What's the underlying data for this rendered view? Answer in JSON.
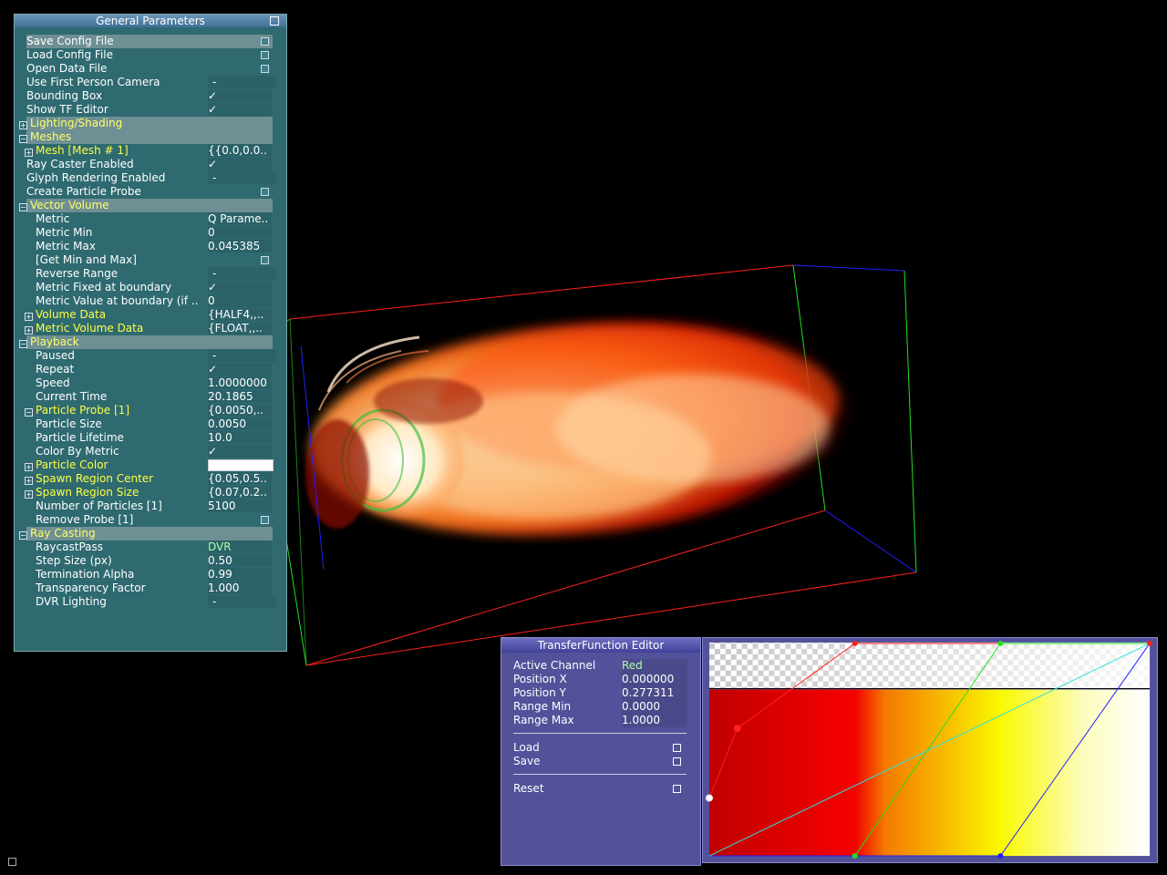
{
  "panel": {
    "title": "General Parameters",
    "items": [
      {
        "label": "Save Config File",
        "type": "button",
        "highlight": true
      },
      {
        "label": "Load Config File",
        "type": "button"
      },
      {
        "label": "Open Data File",
        "type": "button"
      },
      {
        "label": "Use First Person Camera",
        "value": "-"
      },
      {
        "label": "Bounding Box",
        "value": "✓"
      },
      {
        "label": "Show TF Editor",
        "value": "✓"
      },
      {
        "label": "Lighting/Shading",
        "type": "section",
        "expander": "+"
      },
      {
        "label": "Meshes",
        "type": "section",
        "expander": "−"
      },
      {
        "label": "Mesh [Mesh # 1]",
        "value": "{{0.0,0.0..",
        "yellow": true,
        "expander": "+"
      },
      {
        "label": "Ray Caster Enabled",
        "value": "✓"
      },
      {
        "label": "Glyph Rendering Enabled",
        "value": "-"
      },
      {
        "label": "Create Particle Probe",
        "type": "button"
      },
      {
        "label": "Vector Volume",
        "type": "section",
        "expander": "−"
      },
      {
        "label": "Metric",
        "value": "Q Parame..",
        "indent": true
      },
      {
        "label": "Metric Min",
        "value": "0",
        "indent": true
      },
      {
        "label": "Metric Max",
        "value": "0.045385",
        "indent": true
      },
      {
        "label": "[Get Min and Max]",
        "type": "button",
        "indent": true
      },
      {
        "label": "Reverse Range",
        "value": "-",
        "indent": true
      },
      {
        "label": "Metric Fixed at boundary",
        "value": "✓",
        "indent": true
      },
      {
        "label": "Metric Value at boundary (if ..",
        "value": "0",
        "indent": true
      },
      {
        "label": "Volume Data",
        "value": "{HALF4,,..",
        "yellow": true,
        "expander": "+"
      },
      {
        "label": "Metric Volume Data",
        "value": "{FLOAT,,..",
        "yellow": true,
        "expander": "+"
      },
      {
        "label": "Playback",
        "type": "section",
        "expander": "−"
      },
      {
        "label": "Paused",
        "value": "-",
        "indent": true
      },
      {
        "label": "Repeat",
        "value": "✓",
        "indent": true
      },
      {
        "label": "Speed",
        "value": "1.0000000",
        "indent": true
      },
      {
        "label": "Current Time",
        "value": "20.1865",
        "indent": true
      },
      {
        "label": "Particle Probe [1]",
        "value": "{0.0050,..",
        "yellow": true,
        "expander": "−",
        "top": true
      },
      {
        "label": "Particle Size",
        "value": "0.0050",
        "indent": true
      },
      {
        "label": "Particle Lifetime",
        "value": "10.0",
        "indent": true
      },
      {
        "label": "Color By Metric",
        "value": "✓",
        "indent": true
      },
      {
        "label": "Particle Color",
        "value": "",
        "yellow": true,
        "expander": "+",
        "white": true
      },
      {
        "label": "Spawn Region Center",
        "value": "{0.05,0.5..",
        "yellow": true,
        "expander": "+"
      },
      {
        "label": "Spawn Region Size",
        "value": "{0.07,0.2..",
        "yellow": true,
        "expander": "+"
      },
      {
        "label": "Number of Particles [1]",
        "value": "5100",
        "indent": true
      },
      {
        "label": "Remove Probe [1]",
        "type": "button",
        "indent": true
      },
      {
        "label": "Ray Casting",
        "type": "section",
        "expander": "−"
      },
      {
        "label": "RaycastPass",
        "value": "DVR",
        "indent": true,
        "green": true
      },
      {
        "label": "Step Size (px)",
        "value": "0.50",
        "indent": true
      },
      {
        "label": "Termination Alpha",
        "value": "0.99",
        "indent": true
      },
      {
        "label": "Transparency Factor",
        "value": "1.000",
        "indent": true
      },
      {
        "label": "DVR Lighting",
        "value": "-",
        "indent": true
      }
    ]
  },
  "tf_editor": {
    "title": "TransferFunction Editor",
    "fields": [
      {
        "label": "Active Channel",
        "value": "Red"
      },
      {
        "label": "Position X",
        "value": "0.000000"
      },
      {
        "label": "Position Y",
        "value": "0.277311"
      },
      {
        "label": "Range Min",
        "value": "0.0000"
      },
      {
        "label": "Range Max",
        "value": "1.0000"
      }
    ],
    "buttons": [
      "Load",
      "Save",
      "Reset"
    ]
  },
  "colors": {
    "panel_bg": "#2e6a70",
    "section_bg": "#6e8f93",
    "section_text": "#ffff66",
    "tf_bg": "#52519a",
    "bbox_red": "#ff2020",
    "bbox_green": "#20e020",
    "bbox_blue": "#2020ff"
  }
}
